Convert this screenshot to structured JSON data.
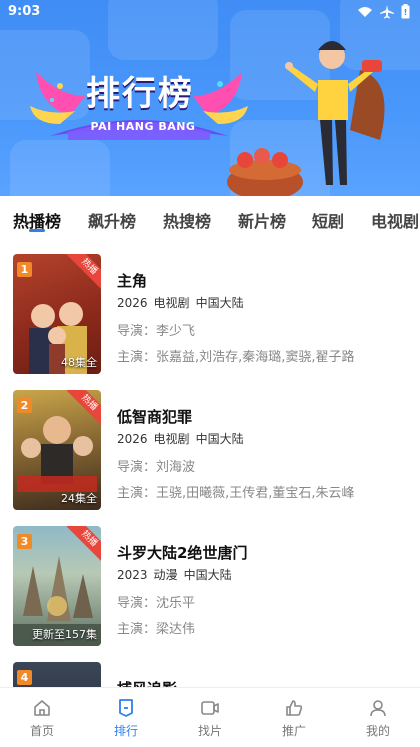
{
  "status": {
    "time": "9:03"
  },
  "banner": {
    "title": "排行榜",
    "subtitle": "PAI HANG BANG"
  },
  "tabs": [
    {
      "label": "热播榜",
      "active": true
    },
    {
      "label": "飙升榜",
      "active": false
    },
    {
      "label": "热搜榜",
      "active": false
    },
    {
      "label": "新片榜",
      "active": false
    },
    {
      "label": "短剧",
      "active": false
    },
    {
      "label": "电视剧",
      "active": false
    }
  ],
  "items": [
    {
      "rank": "1",
      "hot": "热播",
      "episodes": "48集全",
      "title": "主角",
      "year": "2026",
      "category": "电视剧",
      "region": "中国大陆",
      "director": "导演：李少飞",
      "cast": "主演：张嘉益,刘浩存,秦海璐,窦骁,翟子路",
      "poster_colors": [
        "#b4432d",
        "#6d1d14"
      ]
    },
    {
      "rank": "2",
      "hot": "热播",
      "episodes": "24集全",
      "title": "低智商犯罪",
      "year": "2026",
      "category": "电视剧",
      "region": "中国大陆",
      "director": "导演：刘海波",
      "cast": "主演：王骁,田曦薇,王传君,董宝石,朱云峰",
      "poster_colors": [
        "#c9a64a",
        "#3b2a1d"
      ]
    },
    {
      "rank": "3",
      "hot": "热播",
      "episodes": "更新至157集",
      "title": "斗罗大陆2绝世唐门",
      "year": "2023",
      "category": "动漫",
      "region": "中国大陆",
      "director": "导演：沈乐平",
      "cast": "主演：梁达伟",
      "poster_colors": [
        "#8fb9c7",
        "#5d6f60"
      ]
    },
    {
      "rank": "4",
      "hot": "",
      "episodes": "",
      "title": "捕风追影",
      "year": "",
      "category": "",
      "region": "",
      "director": "",
      "cast": "",
      "poster_colors": [
        "#3b4656",
        "#1c2430"
      ]
    }
  ],
  "nav": [
    {
      "label": "首页",
      "icon": "home-icon",
      "active": false
    },
    {
      "label": "排行",
      "icon": "ranking-icon",
      "active": true
    },
    {
      "label": "找片",
      "icon": "video-icon",
      "active": false
    },
    {
      "label": "推广",
      "icon": "thumbs-up-icon",
      "active": false
    },
    {
      "label": "我的",
      "icon": "person-icon",
      "active": false
    }
  ],
  "colors": {
    "accent": "#2f80ed",
    "banner": "#4a98fb",
    "rank": "#f08a29",
    "hot": "#e8463b"
  }
}
